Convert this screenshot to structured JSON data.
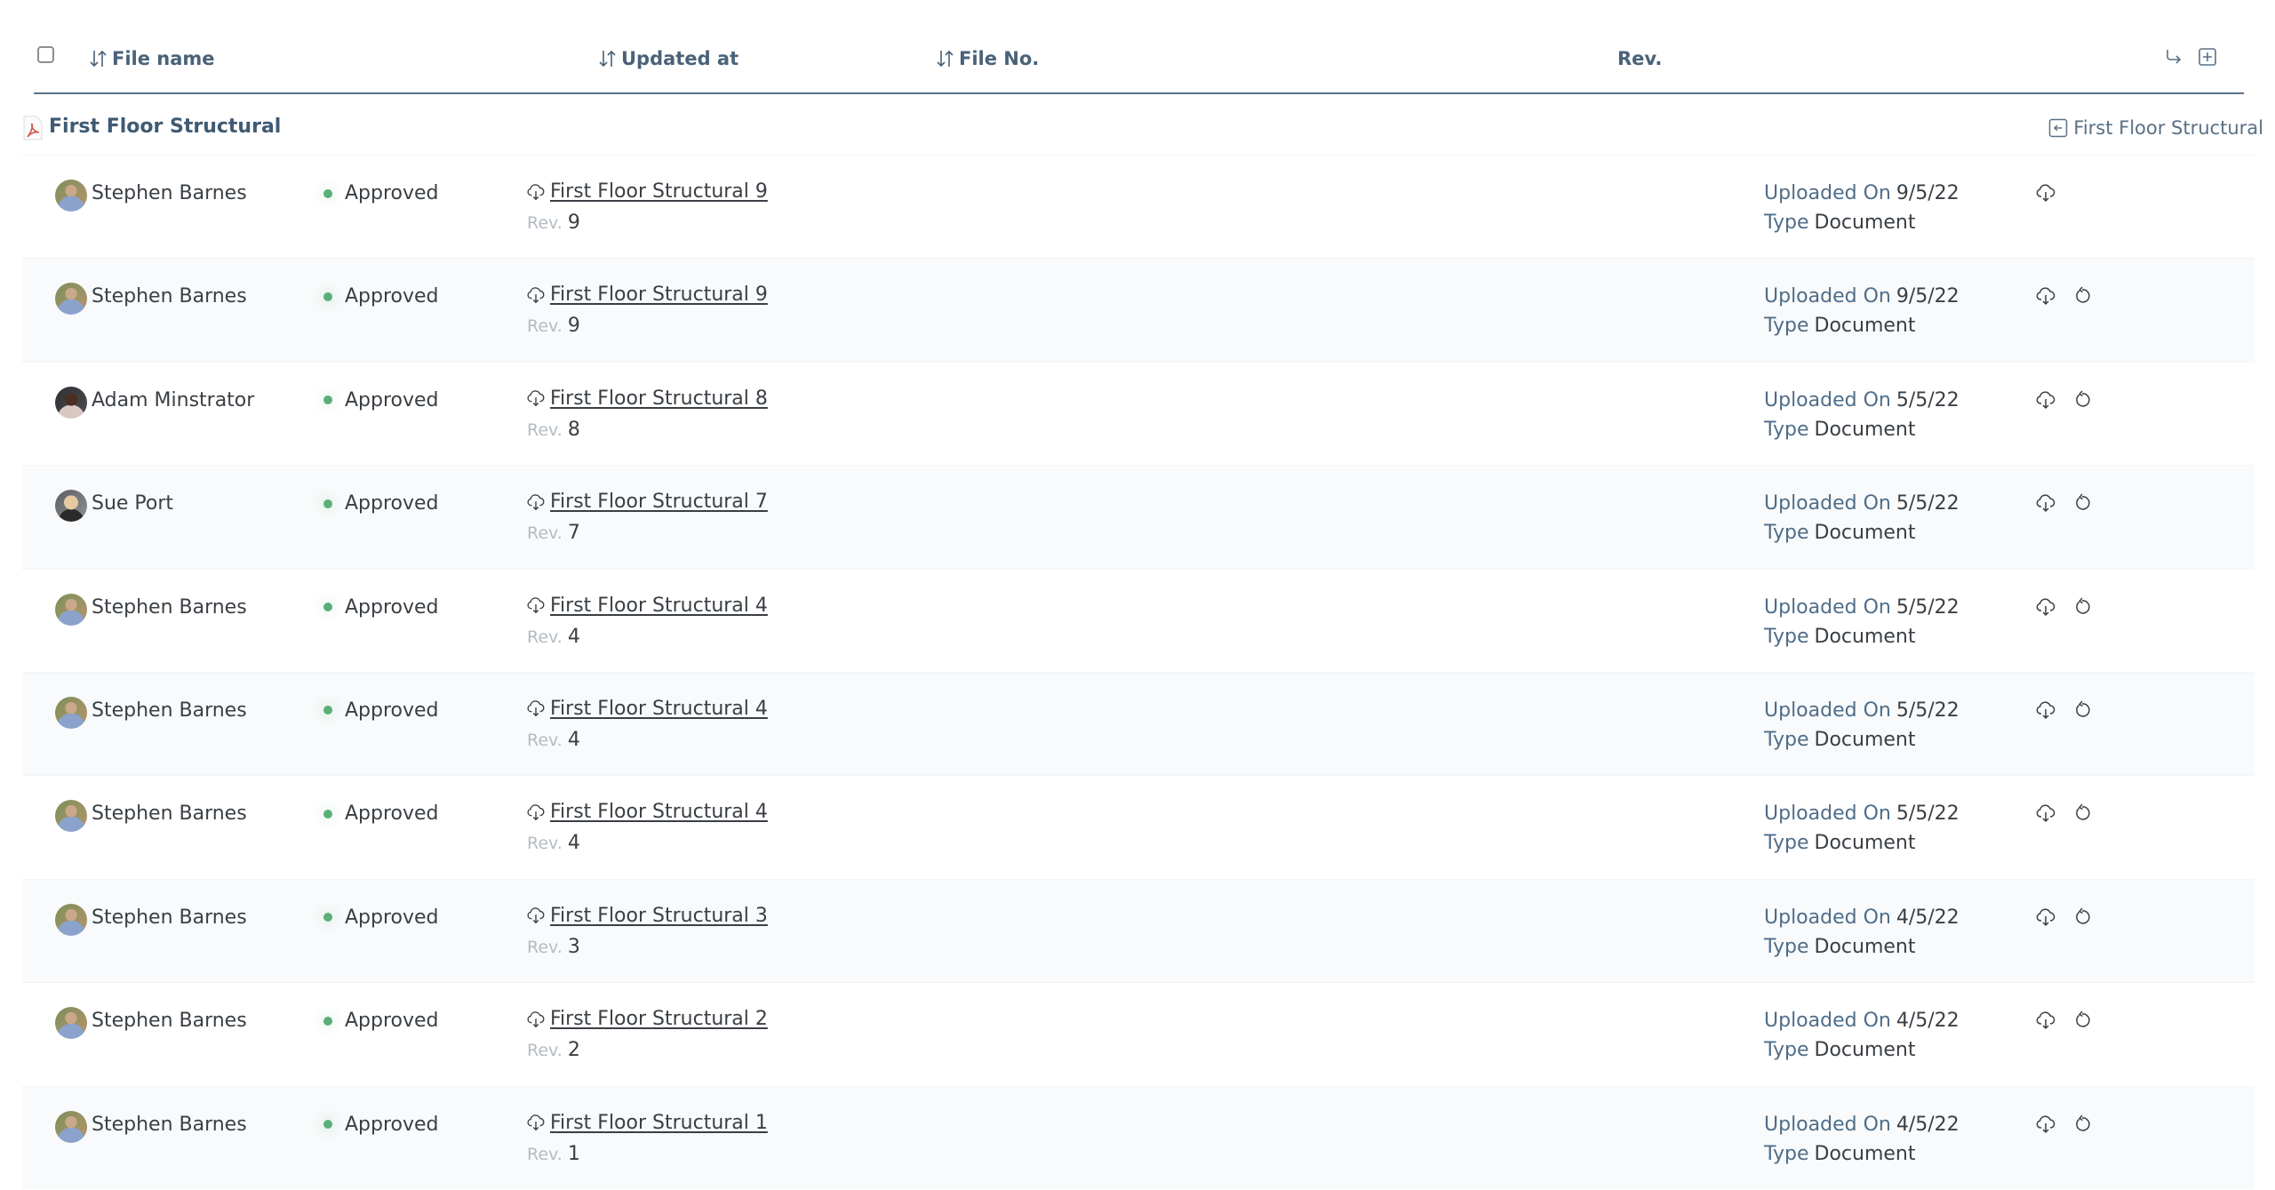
{
  "header": {
    "select_all_checked": false,
    "columns": [
      {
        "label": "File name",
        "sortable": true
      },
      {
        "label": "Updated at",
        "sortable": true
      },
      {
        "label": "File No.",
        "sortable": true
      },
      {
        "label": "Rev.",
        "sortable": false
      }
    ],
    "actions": [
      {
        "icon": "share-arrow-icon"
      },
      {
        "icon": "add-square-icon"
      }
    ]
  },
  "group": {
    "icon": "pdf-file-icon",
    "title": "First Floor Structural",
    "right_link": {
      "icon": "back-square-icon",
      "label": "First Floor Structural"
    }
  },
  "labels": {
    "rev": "Rev.",
    "uploaded_on": "Uploaded On",
    "type": "Type"
  },
  "colors": {
    "accent": "#4a6278",
    "status_approved": "#5aaf78",
    "label_blue": "#4f6d88",
    "row_alt_bg": "#f8fafb"
  },
  "rows": [
    {
      "user": "Stephen Barnes",
      "avatar": "stephen",
      "status": "Approved",
      "file": "First Floor Structural 9",
      "rev": "9",
      "uploaded_on": "9/5/22",
      "type": "Document",
      "restore": false
    },
    {
      "user": "Stephen Barnes",
      "avatar": "stephen",
      "status": "Approved",
      "file": "First Floor Structural 9",
      "rev": "9",
      "uploaded_on": "9/5/22",
      "type": "Document",
      "restore": true
    },
    {
      "user": "Adam Minstrator",
      "avatar": "adam",
      "status": "Approved",
      "file": "First Floor Structural 8",
      "rev": "8",
      "uploaded_on": "5/5/22",
      "type": "Document",
      "restore": true
    },
    {
      "user": "Sue Port",
      "avatar": "sue",
      "status": "Approved",
      "file": "First Floor Structural 7",
      "rev": "7",
      "uploaded_on": "5/5/22",
      "type": "Document",
      "restore": true
    },
    {
      "user": "Stephen Barnes",
      "avatar": "stephen",
      "status": "Approved",
      "file": "First Floor Structural 4",
      "rev": "4",
      "uploaded_on": "5/5/22",
      "type": "Document",
      "restore": true
    },
    {
      "user": "Stephen Barnes",
      "avatar": "stephen",
      "status": "Approved",
      "file": "First Floor Structural 4",
      "rev": "4",
      "uploaded_on": "5/5/22",
      "type": "Document",
      "restore": true
    },
    {
      "user": "Stephen Barnes",
      "avatar": "stephen",
      "status": "Approved",
      "file": "First Floor Structural 4",
      "rev": "4",
      "uploaded_on": "5/5/22",
      "type": "Document",
      "restore": true
    },
    {
      "user": "Stephen Barnes",
      "avatar": "stephen",
      "status": "Approved",
      "file": "First Floor Structural 3",
      "rev": "3",
      "uploaded_on": "4/5/22",
      "type": "Document",
      "restore": true
    },
    {
      "user": "Stephen Barnes",
      "avatar": "stephen",
      "status": "Approved",
      "file": "First Floor Structural 2",
      "rev": "2",
      "uploaded_on": "4/5/22",
      "type": "Document",
      "restore": true
    },
    {
      "user": "Stephen Barnes",
      "avatar": "stephen",
      "status": "Approved",
      "file": "First Floor Structural 1",
      "rev": "1",
      "uploaded_on": "4/5/22",
      "type": "Document",
      "restore": true
    }
  ]
}
